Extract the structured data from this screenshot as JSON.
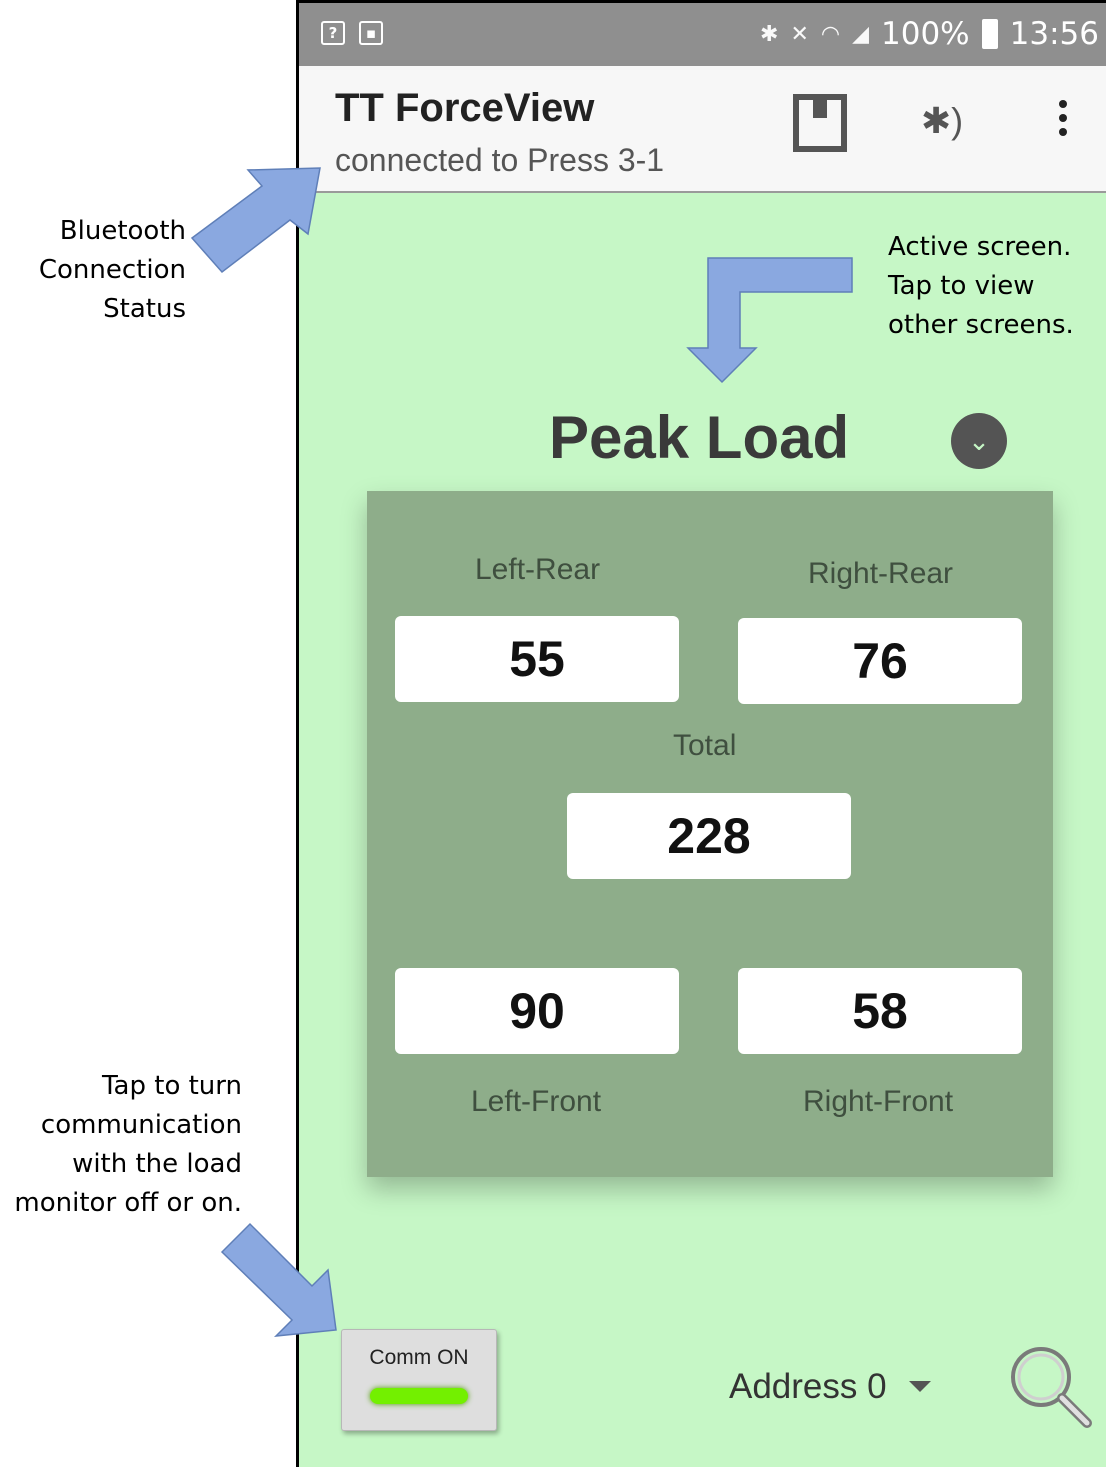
{
  "status_bar": {
    "left_icons": [
      "question-mark-box",
      "image-box"
    ],
    "battery": "100%",
    "time": "13:56"
  },
  "app_bar": {
    "title": "TT ForceView",
    "subtitle": "connected to Press 3-1"
  },
  "screen": {
    "title": "Peak Load",
    "cells": {
      "left_rear": {
        "label": "Left-Rear",
        "value": "55"
      },
      "right_rear": {
        "label": "Right-Rear",
        "value": "76"
      },
      "total": {
        "label": "Total",
        "value": "228"
      },
      "left_front": {
        "label": "Left-Front",
        "value": "90"
      },
      "right_front": {
        "label": "Right-Front",
        "value": "58"
      }
    }
  },
  "bottom_bar": {
    "comm_label": "Comm ON",
    "address": "Address 0"
  },
  "annotations": {
    "bluetooth": [
      "Bluetooth",
      "Connection",
      "Status"
    ],
    "active_screen": [
      "Active screen.",
      "Tap to view",
      "other screens."
    ],
    "comm": [
      "Tap to turn",
      "communication",
      "with the load",
      "monitor off or on."
    ]
  },
  "colors": {
    "screen_bg": "#c6f7c6",
    "panel": "#8ead8a",
    "arrow": "#8aa8e0",
    "led": "#73f000"
  }
}
